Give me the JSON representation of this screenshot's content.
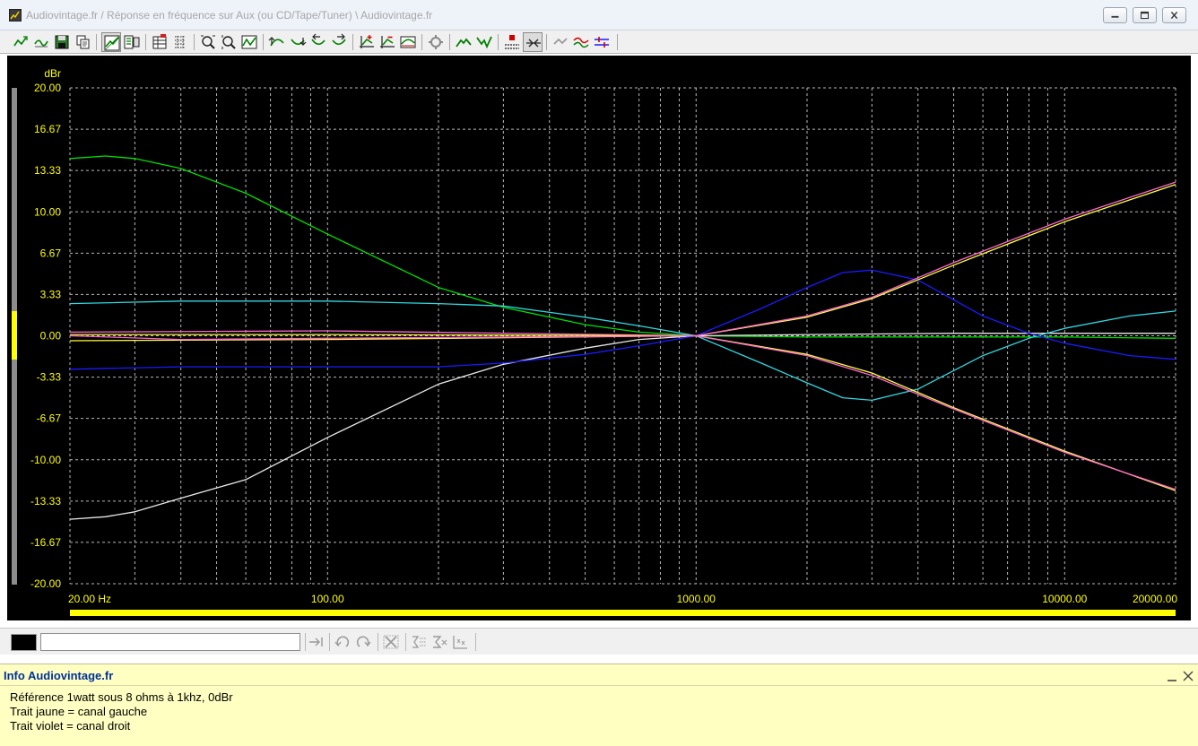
{
  "window": {
    "title": "Audiovintage.fr   /   Réponse en fréquence sur Aux (ou CD/Tape/Tuner)   \\   Audiovintage.fr"
  },
  "toolbar": {
    "icons": [
      "curve-add-icon",
      "curve-edit-icon",
      "save-icon",
      "copy-icon",
      "graph-view-icon",
      "graph-options-icon",
      "table-icon",
      "grid-icon",
      "zoom-x-icon",
      "zoom-y-icon",
      "fit-curve-icon",
      "shift-up-icon",
      "shift-down-icon",
      "shift-left-icon",
      "shift-right-icon",
      "marker-add-icon",
      "marker-remove-icon",
      "marker-curve-icon",
      "settings-icon",
      "cursor-down-icon",
      "cursor-up-icon",
      "pixel-icon",
      "overlay-icon",
      "undo-curve-icon",
      "average-icon",
      "adjust-icon"
    ]
  },
  "chart_data": {
    "type": "line",
    "ylabel": "dBr",
    "x_scale": "log",
    "xlim": [
      20,
      20000
    ],
    "ylim": [
      -20,
      20
    ],
    "grid": true,
    "y_ticks": [
      "20.00",
      "16.67",
      "13.33",
      "10.00",
      "6.67",
      "3.33",
      "0.00",
      "-3.33",
      "-6.67",
      "-10.00",
      "-13.33",
      "-16.67",
      "-20.00"
    ],
    "x_tick_labels": [
      {
        "x": 20,
        "label": "20.00 Hz"
      },
      {
        "x": 100,
        "label": "100.00"
      },
      {
        "x": 1000,
        "label": "1000.00"
      },
      {
        "x": 10000,
        "label": "10000.00"
      },
      {
        "x": 20000,
        "label": "20000.00"
      }
    ],
    "series": [
      {
        "color": "#00e000",
        "x": [
          20,
          25,
          30,
          40,
          60,
          100,
          200,
          300,
          500,
          700,
          1000,
          2000,
          5000,
          10000,
          20000
        ],
        "y": [
          14.3,
          14.5,
          14.3,
          13.5,
          11.5,
          8.2,
          3.9,
          2.3,
          0.9,
          0.3,
          0.0,
          -0.1,
          -0.1,
          -0.1,
          -0.2
        ]
      },
      {
        "color": "#e8e8e8",
        "x": [
          20,
          25,
          30,
          40,
          60,
          100,
          200,
          300,
          500,
          700,
          1000,
          2000,
          5000,
          10000,
          20000
        ],
        "y": [
          -14.8,
          -14.6,
          -14.2,
          -13.1,
          -11.6,
          -8.2,
          -3.9,
          -2.3,
          -1.0,
          -0.3,
          0.0,
          0.1,
          0.2,
          0.2,
          0.2
        ]
      },
      {
        "color": "#30d8e0",
        "x": [
          20,
          40,
          100,
          200,
          300,
          500,
          700,
          1000,
          1500,
          2000,
          2500,
          3000,
          4000,
          6000,
          8000,
          10000,
          15000,
          20000
        ],
        "y": [
          2.6,
          2.8,
          2.8,
          2.6,
          2.4,
          1.5,
          0.8,
          0.0,
          -2.2,
          -3.8,
          -5.0,
          -5.2,
          -4.3,
          -1.6,
          -0.2,
          0.6,
          1.6,
          2.0
        ]
      },
      {
        "color": "#1a1aff",
        "x": [
          20,
          40,
          100,
          200,
          300,
          500,
          700,
          1000,
          1500,
          2000,
          2500,
          3000,
          4000,
          6000,
          8000,
          10000,
          15000,
          20000
        ],
        "y": [
          -2.7,
          -2.5,
          -2.5,
          -2.5,
          -2.2,
          -1.5,
          -0.8,
          0.0,
          2.2,
          3.9,
          5.1,
          5.3,
          4.5,
          1.6,
          0.2,
          -0.6,
          -1.6,
          -1.9
        ]
      },
      {
        "color": "#ffff40",
        "x": [
          20,
          100,
          1000,
          2000,
          3000,
          5000,
          10000,
          20000
        ],
        "y": [
          -0.4,
          -0.3,
          0.0,
          1.5,
          3.0,
          5.7,
          9.2,
          12.2
        ]
      },
      {
        "color": "#ff66d0",
        "x": [
          20,
          100,
          1000,
          2000,
          3000,
          5000,
          10000,
          20000
        ],
        "y": [
          0.3,
          0.4,
          0.0,
          1.6,
          3.1,
          5.9,
          9.4,
          12.4
        ]
      },
      {
        "color": "#ffff40",
        "x": [
          20,
          100,
          1000,
          2000,
          3000,
          5000,
          10000,
          20000
        ],
        "y": [
          0.1,
          0.1,
          0.0,
          -1.5,
          -3.0,
          -5.8,
          -9.3,
          -12.5
        ]
      },
      {
        "color": "#ff66d0",
        "x": [
          20,
          40,
          100,
          1000,
          2000,
          3000,
          5000,
          10000,
          20000
        ],
        "y": [
          0.0,
          -0.3,
          -0.2,
          0.0,
          -1.6,
          -3.2,
          -5.9,
          -9.4,
          -12.4
        ]
      }
    ]
  },
  "statusbar": {
    "input_value": "",
    "icons": [
      "arrow-merge-icon",
      "rotate-left-icon",
      "rotate-right-icon",
      "delete-all-icon",
      "sum-options-icon",
      "sum-icon",
      "stats-icon"
    ]
  },
  "info": {
    "title": "Info Audiovintage.fr",
    "lines": [
      "Référence 1watt sous 8 ohms à 1khz, 0dBr",
      "Trait jaune = canal gauche",
      "Trait violet = canal droit"
    ]
  },
  "colors": {
    "axis_text": "#ffff00",
    "grid": "#b8b8b8",
    "info_title": "#00319c",
    "info_bg": "#ffffc1"
  }
}
